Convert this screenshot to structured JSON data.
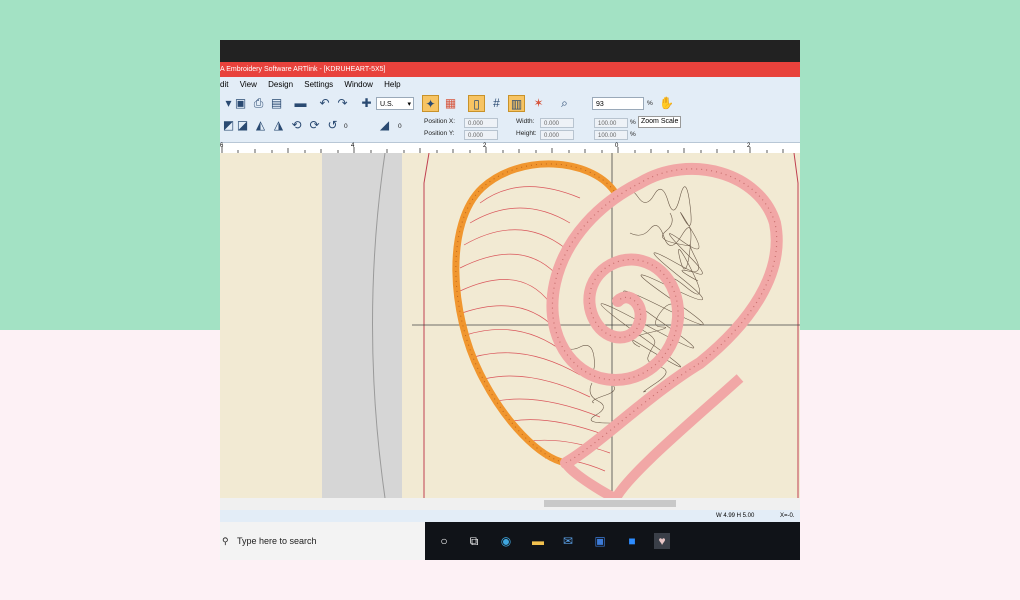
{
  "window": {
    "title": "A Embroidery Software ARTlink - [KDRUHEART-5X5]"
  },
  "menu": [
    "dit",
    "View",
    "Design",
    "Settings",
    "Window",
    "Help"
  ],
  "toolbar": {
    "units_value": "U.S.",
    "zoom_value": "93",
    "zoom_suffix": "%",
    "tooltip": "Zoom Scale",
    "rotate_value": "0",
    "slant_value": "0"
  },
  "props": {
    "position_x_label": "Position X:",
    "position_x_value": "0.000",
    "position_y_label": "Position Y:",
    "position_y_value": "0.000",
    "width_label": "Width:",
    "width_value": "0.000",
    "height_label": "Height:",
    "height_value": "0.000",
    "scale_w_value": "100.00",
    "scale_h_value": "100.00",
    "percent": "%"
  },
  "ruler": {
    "labels": [
      "6",
      "4",
      "2",
      "0",
      "2"
    ]
  },
  "status": {
    "size_text": "W 4.99 H 5.00",
    "coord_text": "X=-0."
  },
  "taskbar": {
    "search_placeholder": "Type here to search"
  },
  "colors": {
    "title_bar": "#e8423c",
    "toolbar_bg": "#e3edf7",
    "canvas_bg": "#f2ead3",
    "hoop_gray": "#d6d6d6",
    "orange_outline": "#f0962f",
    "pink_spiral": "#f1a7a6",
    "red_stitches": "#d9555a"
  }
}
